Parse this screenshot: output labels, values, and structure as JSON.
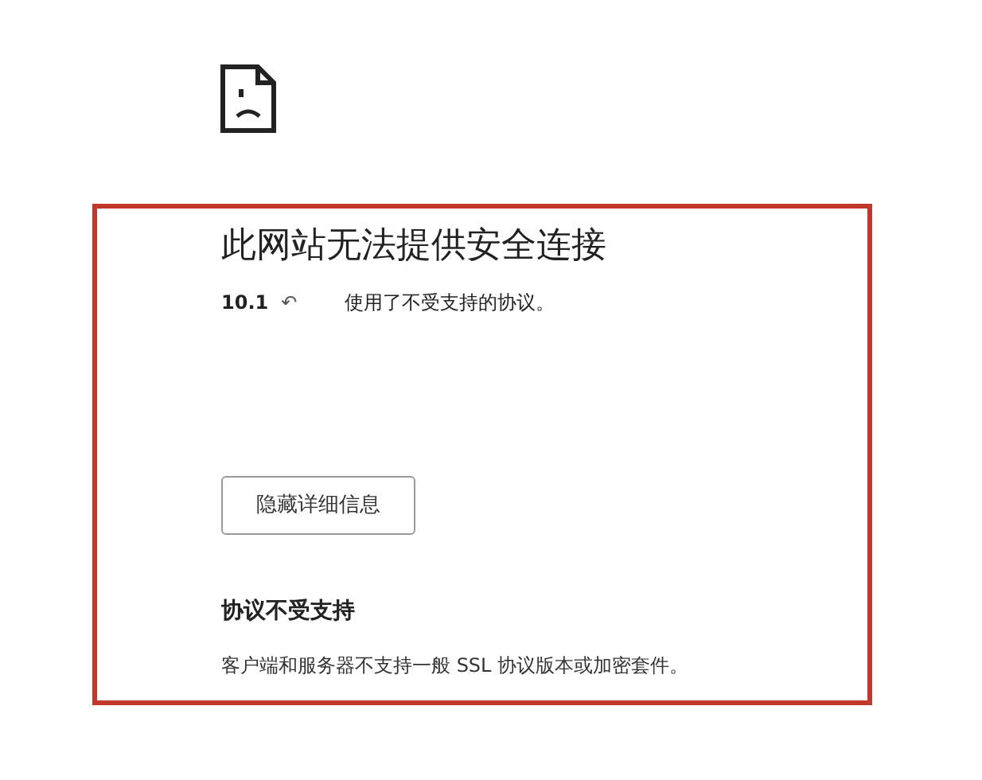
{
  "error_title": "此网站无法提供安全连接",
  "detail_line": {
    "host": "10.1",
    "arrow": "↶",
    "message": "使用了不受支持的协议。"
  },
  "button": {
    "label": "隐藏详细信息"
  },
  "section": {
    "heading": "协议不受支持",
    "body": "客户端和服务器不支持一般 SSL 协议版本或加密套件。"
  }
}
